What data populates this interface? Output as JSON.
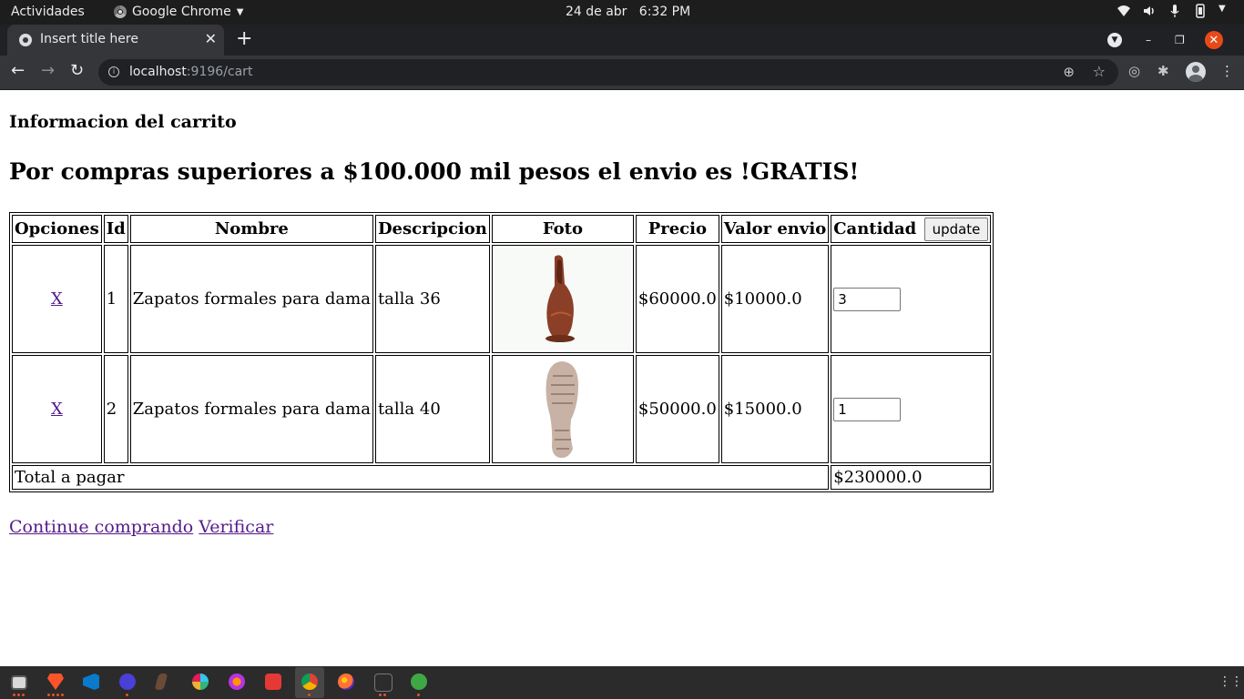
{
  "system": {
    "activities": "Actividades",
    "app_name": "Google Chrome",
    "clock": "24 de abr   6:32 PM"
  },
  "browser": {
    "tab_title": "Insert title here",
    "url_host": "localhost",
    "url_path": ":9196/cart"
  },
  "page": {
    "heading": "Informacion del carrito",
    "promo": "Por compras superiores a $100.000 mil pesos el envio es !GRATIS!",
    "table": {
      "headers": {
        "opciones": "Opciones",
        "id": "Id",
        "nombre": "Nombre",
        "descripcion": "Descripcion",
        "foto": "Foto",
        "precio": "Precio",
        "valor_envio": "Valor envio",
        "cantidad": "Cantidad"
      },
      "update_label": "update",
      "rows": [
        {
          "remove": "X",
          "id": "1",
          "nombre": "Zapatos formales para dama",
          "descripcion": "talla 36",
          "precio": "$60000.0",
          "valor_envio": "$10000.0",
          "cantidad": "3"
        },
        {
          "remove": "X",
          "id": "2",
          "nombre": "Zapatos formales para dama",
          "descripcion": "talla 40",
          "precio": "$50000.0",
          "valor_envio": "$15000.0",
          "cantidad": "1"
        }
      ],
      "total_label": "Total a pagar",
      "total_value": "$230000.0"
    },
    "links": {
      "continue": "Continue comprando",
      "verify": "Verificar"
    }
  },
  "colors": {
    "link": "#551a8b",
    "close_button": "#e64a19",
    "dock_indicator": "#e95420"
  }
}
